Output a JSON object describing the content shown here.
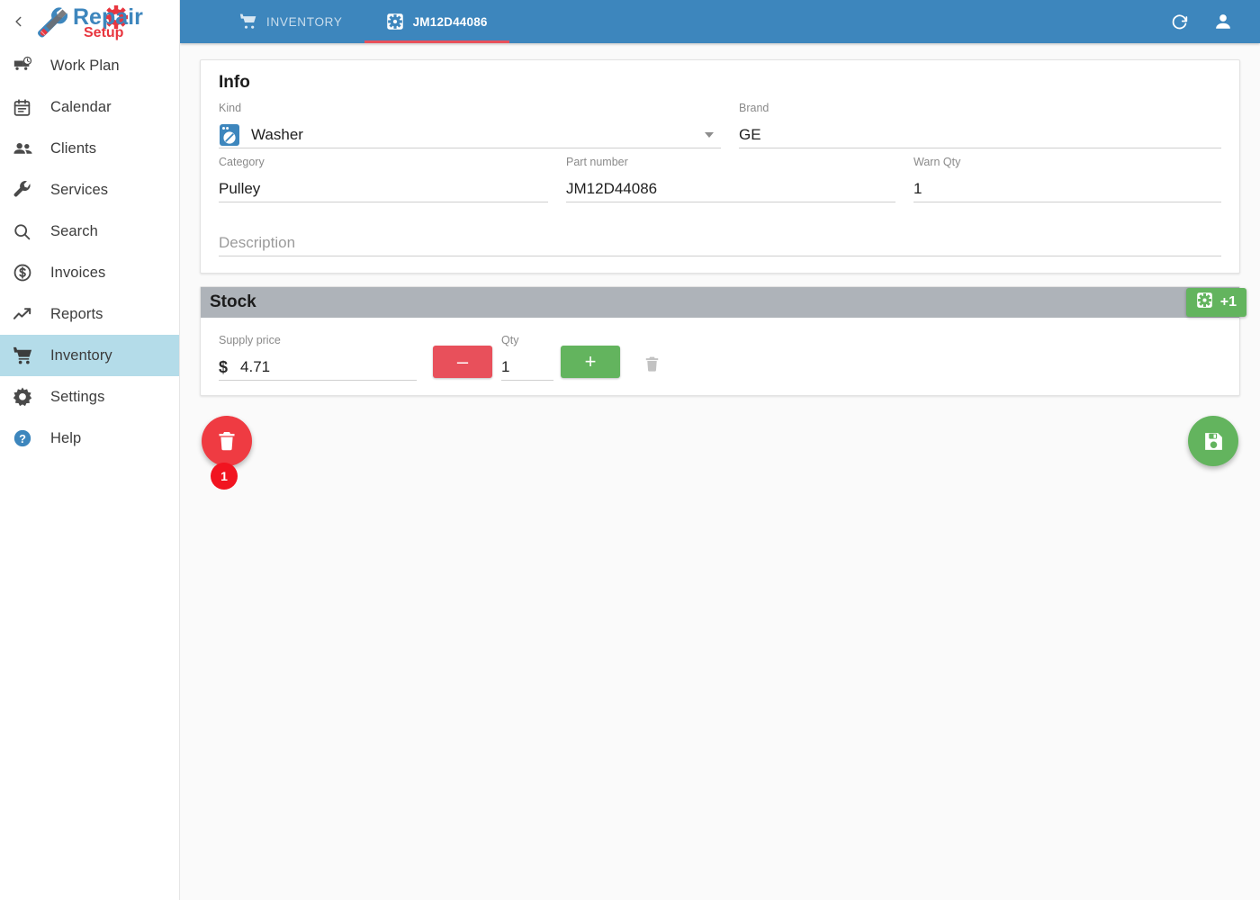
{
  "app": {
    "logo_text_primary": "Repair",
    "logo_text_secondary": "Setup",
    "brand_blue": "#3d86bd",
    "accent_red": "#e8505b",
    "accent_green": "#63b45e",
    "active_nav_bg": "#b4dce9"
  },
  "sidebar": {
    "collapse_icon": "chevron-left-icon",
    "items": [
      {
        "label": "Work Plan",
        "icon": "work-plan-icon",
        "active": false
      },
      {
        "label": "Calendar",
        "icon": "calendar-icon",
        "active": false
      },
      {
        "label": "Clients",
        "icon": "clients-icon",
        "active": false
      },
      {
        "label": "Services",
        "icon": "wrench-icon",
        "active": false
      },
      {
        "label": "Search",
        "icon": "search-icon",
        "active": false
      },
      {
        "label": "Invoices",
        "icon": "dollar-circle-icon",
        "active": false
      },
      {
        "label": "Reports",
        "icon": "trending-up-icon",
        "active": false
      },
      {
        "label": "Inventory",
        "icon": "cart-icon",
        "active": true
      },
      {
        "label": "Settings",
        "icon": "gear-icon",
        "active": false
      },
      {
        "label": "Help",
        "icon": "help-circle-icon",
        "active": false
      }
    ]
  },
  "topbar": {
    "tabs": [
      {
        "label": "INVENTORY",
        "icon": "cart-icon",
        "active": false
      },
      {
        "label": "JM12D44086",
        "icon": "part-gear-icon",
        "active": true
      }
    ],
    "refresh_icon": "refresh-icon",
    "account_icon": "person-icon"
  },
  "info": {
    "title": "Info",
    "kind": {
      "label": "Kind",
      "value": "Washer",
      "icon": "washer-icon",
      "dropdown_icon": "chevron-down-icon"
    },
    "brand": {
      "label": "Brand",
      "value": "GE"
    },
    "category": {
      "label": "Category",
      "value": "Pulley"
    },
    "part_number": {
      "label": "Part number",
      "value": "JM12D44086"
    },
    "warn_qty": {
      "label": "Warn Qty",
      "value": "1"
    },
    "description": {
      "label": "",
      "placeholder": "Description",
      "value": ""
    }
  },
  "stock": {
    "title": "Stock",
    "add_badge": {
      "label": "+1",
      "icon": "part-gear-icon"
    },
    "rows": [
      {
        "supply_price_label": "Supply price",
        "currency_symbol": "$",
        "supply_price": "4.71",
        "qty_label": "Qty",
        "qty": "1",
        "minus_label": "—",
        "plus_label": "+",
        "delete_icon": "trash-icon"
      }
    ]
  },
  "actions": {
    "delete_fab": {
      "icon": "trash-icon",
      "badge": "1"
    },
    "save_fab": {
      "icon": "save-icon"
    }
  }
}
